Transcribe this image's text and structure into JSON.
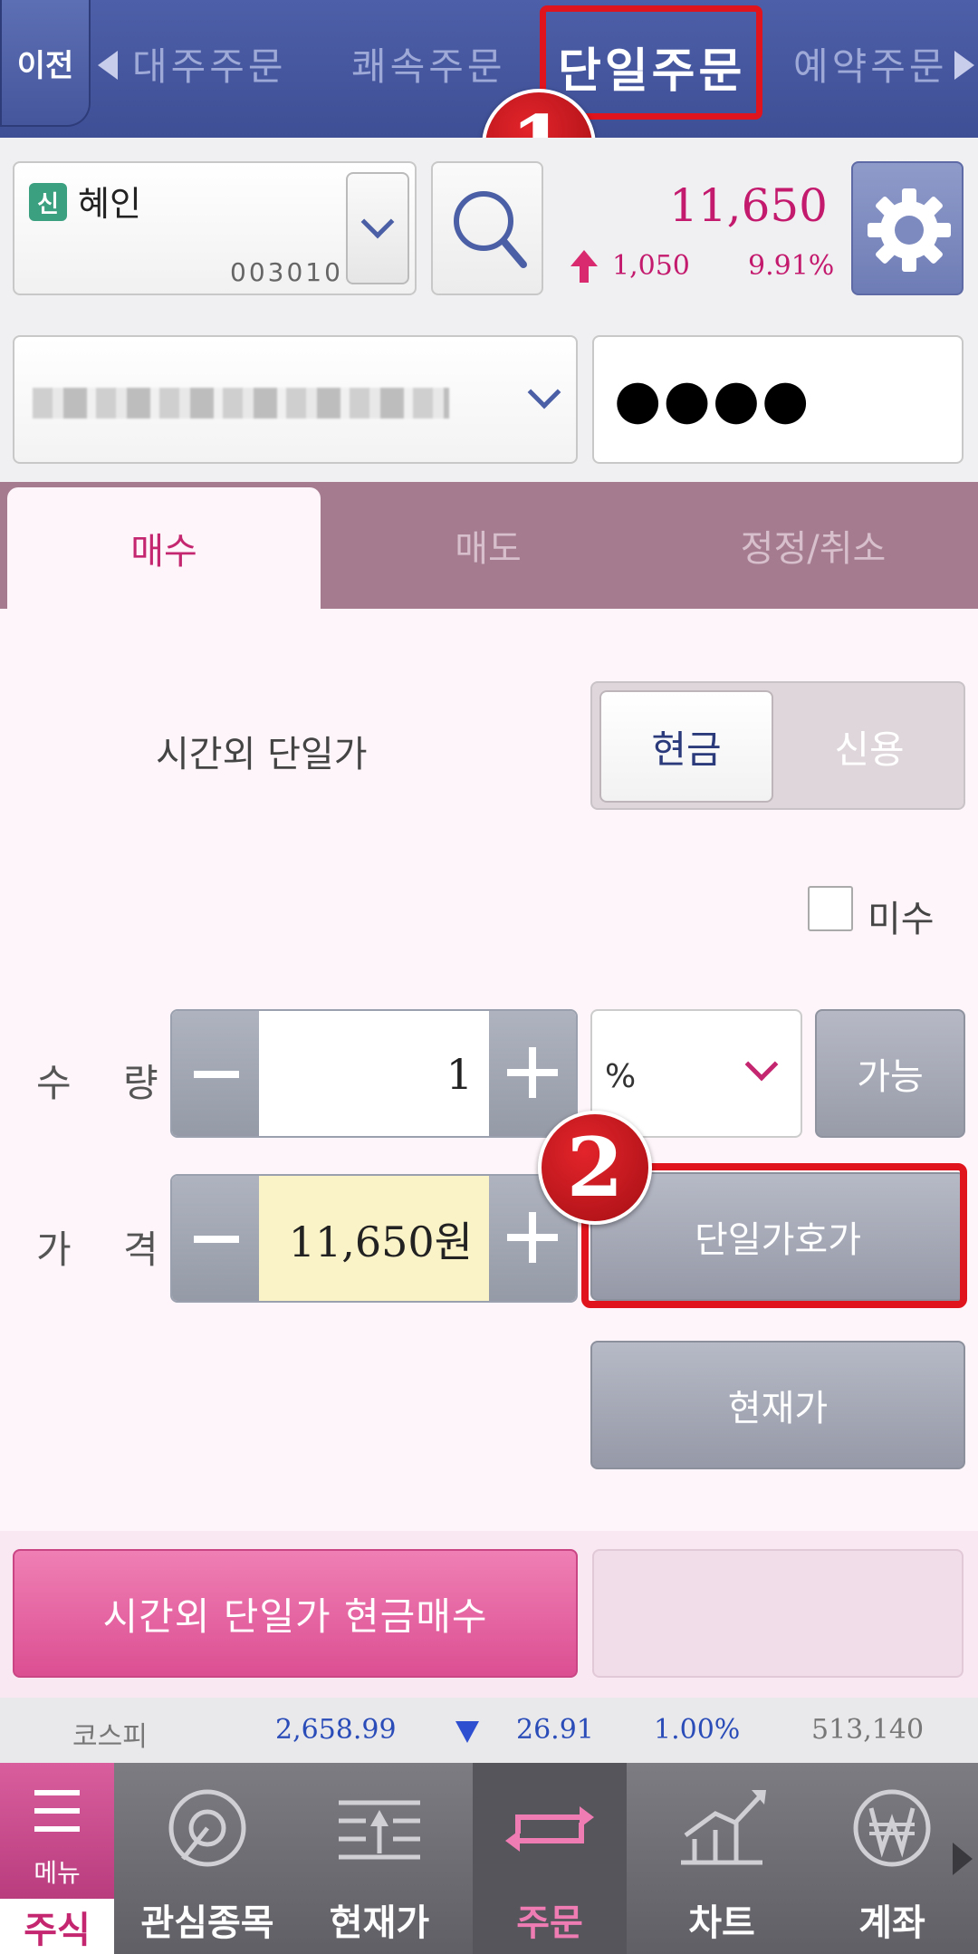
{
  "top_nav": {
    "prev_label": "이전",
    "items": [
      "대주주문",
      "쾌속주문",
      "단일주문",
      "예약주문"
    ],
    "active_index": 2
  },
  "annotations": {
    "badge1": "1",
    "badge2": "2"
  },
  "stock": {
    "badge": "신",
    "name": "혜인",
    "code": "003010",
    "price": "11,650",
    "change": "1,050",
    "change_pct": "9.91%"
  },
  "account": {
    "password_mask": "●●●●"
  },
  "tabs": [
    "매수",
    "매도",
    "정정/취소"
  ],
  "order": {
    "session_label": "시간외 단일가",
    "cash_label": "현금",
    "credit_label": "신용",
    "unpaid_label": "미수",
    "qty_label": "수 량",
    "qty_value": "1",
    "pct_label": "%",
    "avail_label": "가능",
    "price_label": "가 격",
    "price_value": "11,650원",
    "single_quote_label": "단일가호가",
    "current_price_label": "현재가",
    "submit_label": "시간외 단일가 현금매수"
  },
  "ticker": {
    "name": "코스피",
    "value": "2,658.99",
    "change": "26.91",
    "pct": "1.00%",
    "volume": "513,140"
  },
  "bottom_nav": {
    "menu_label": "메뉴",
    "stock_label": "주식",
    "items": [
      "관심종목",
      "현재가",
      "주문",
      "차트",
      "계좌"
    ]
  },
  "colors": {
    "accent": "#c4266f",
    "nav_blue": "#4d5fa8",
    "highlight": "#e0141c"
  }
}
